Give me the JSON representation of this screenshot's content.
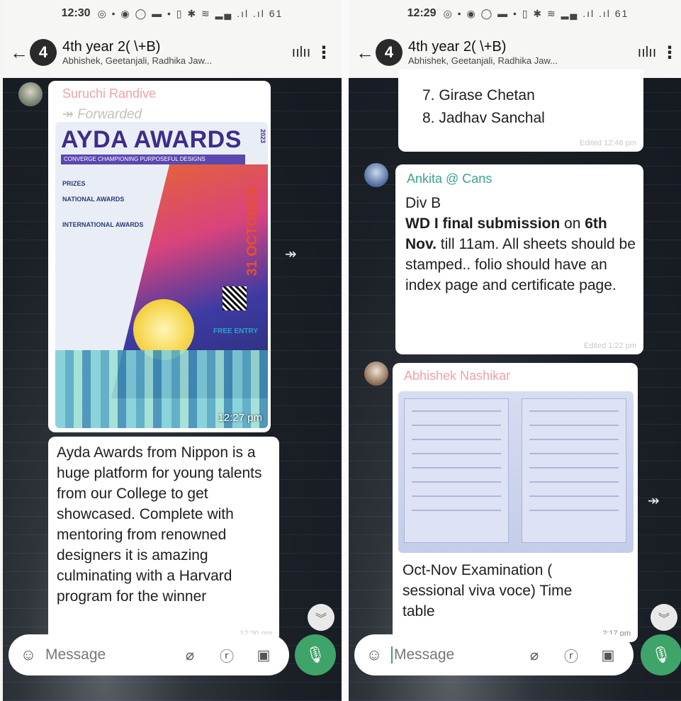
{
  "left": {
    "status": {
      "time": "12:30",
      "icons": "◎ • ◉ ◯ ▬ • ▯ ✱ ≋ ▂▄ .ıl .ıl 61"
    },
    "header": {
      "avatar": "4",
      "title": "4th year 2(              \\+B)",
      "subtitle": "Abhishek, Geetanjali, Radhika Jaw..."
    },
    "post": {
      "sender": "Suruchi Randive",
      "forwarded": "Forwarded",
      "poster_title": "AYDA AWARDS",
      "poster_strip": "CONVERGE CHAMPIONING PURPOSEFUL DESIGNS",
      "poster_prizes": "PRIZES",
      "poster_national": "NATIONAL AWARDS",
      "poster_international": "INTERNATIONAL AWARDS",
      "poster_date": "31 OCTOBER",
      "poster_year": "2023",
      "poster_free": "FREE ENTRY",
      "time": "12:27 pm"
    },
    "caption": {
      "text": "Ayda Awards from Nippon is a huge platform for young talents from our College to get showcased. Complete with mentoring from renowned designers it is amazing culminating with a Harvard program for the winner",
      "time": "12:30 pm"
    },
    "input": {
      "placeholder": "Message"
    }
  },
  "right": {
    "status": {
      "time": "12:29",
      "icons": "◎ • ◉ ◯ ▬ • ▯ ✱ ≋ ▂▄ .ıl .ıl 61"
    },
    "header": {
      "avatar": "4",
      "title": "4th year 2(              \\+B)",
      "subtitle": "Abhishek, Geetanjali, Radhika Jaw..."
    },
    "list_tail": {
      "items": [
        "7. Girase Chetan",
        "8. Jadhav Sanchal"
      ],
      "time": "Edited 12:46 pm"
    },
    "notice": {
      "sender": "Ankita @ Cans",
      "line1": "Div B",
      "bold1": "WD I final submission",
      "mid1": " on ",
      "bold2": "6th Nov.",
      "rest": " till 11am. All sheets should be stamped.. folio should have an index page and certificate page.",
      "time": "Edited 1:22 pm"
    },
    "timetable": {
      "sender": "Abhishek Nashikar",
      "caption": "Oct-Nov Examination ( sessional viva voce) Time table",
      "time": "2:17 pm"
    },
    "input": {
      "placeholder": "Message"
    }
  }
}
